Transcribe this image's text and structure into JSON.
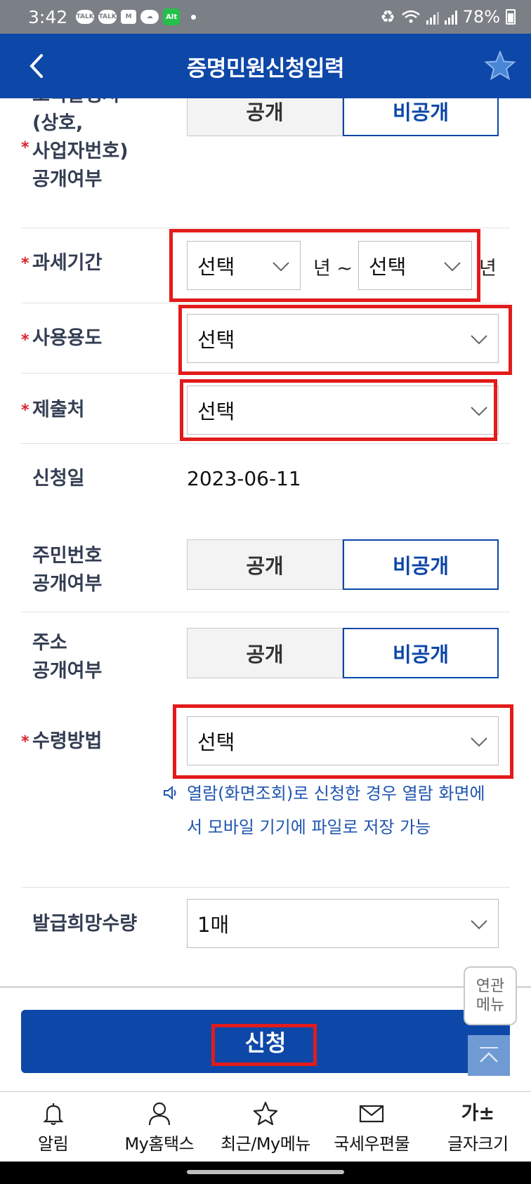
{
  "status": {
    "time": "3:42",
    "battery": "78%",
    "notifs": [
      "TALK",
      "TALK",
      "M",
      "",
      "Alt"
    ]
  },
  "header": {
    "title": "증명민원신청입력"
  },
  "form": {
    "company_disclosure": {
      "label_lines": [
        "소득발생처",
        "(상호,",
        "사업자번호)",
        "공개여부"
      ],
      "public": "공개",
      "private": "비공개"
    },
    "tax_period": {
      "label": "과세기간",
      "from_value": "선택",
      "year1": "년 ~",
      "to_value": "선택",
      "year2": "년"
    },
    "usage": {
      "label": "사용용도",
      "value": "선택"
    },
    "submit_to": {
      "label": "제출처",
      "value": "선택"
    },
    "apply_date": {
      "label": "신청일",
      "value": "2023-06-11"
    },
    "resident_no_disclosure": {
      "label_lines": [
        "주민번호",
        "공개여부"
      ],
      "public": "공개",
      "private": "비공개"
    },
    "address_disclosure": {
      "label_lines": [
        "주소",
        "공개여부"
      ],
      "public": "공개",
      "private": "비공개"
    },
    "receive_method": {
      "label": "수령방법",
      "value": "선택"
    },
    "notice": "열람(화면조회)로 신청한 경우 열람 화면에서 모바일 기기에 파일로 저장 가능",
    "quantity": {
      "label": "발급희망수량",
      "value": "1매"
    }
  },
  "submit_label": "신청",
  "related_menu": [
    "연관",
    "메뉴"
  ],
  "bottom_nav": [
    {
      "label": "알림",
      "icon": "bell-icon"
    },
    {
      "label": "My홈택스",
      "icon": "person-icon"
    },
    {
      "label": "최근/My메뉴",
      "icon": "star-icon"
    },
    {
      "label": "국세우편물",
      "icon": "mail-icon"
    },
    {
      "label": "글자크기",
      "icon": "font-size-icon",
      "glyph": "가±"
    }
  ],
  "colors": {
    "primary": "#0d47a8",
    "required": "#d8232a",
    "highlight": "#e21b1b",
    "notice": "#1f55b0"
  }
}
